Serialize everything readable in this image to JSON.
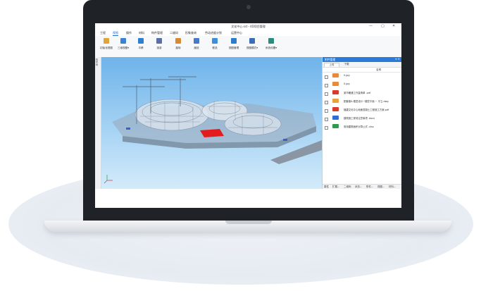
{
  "app": {
    "title": "文化中心.sst - 4D项目管理",
    "window_controls": [
      "—",
      "▢",
      "✕"
    ]
  },
  "menu": {
    "items": [
      "工程",
      "视图",
      "操作",
      "材料",
      "构件管理",
      "二维码",
      "形象查询",
      "劳动进度计划",
      "运营中心"
    ],
    "active": "视图"
  },
  "ribbon": {
    "tools": [
      {
        "label": "初始化视图",
        "icon": "reset-view-icon",
        "color": "#e0a43a"
      },
      {
        "label": "三维视图",
        "icon": "3d-view-icon",
        "color": "#3b82d6",
        "dropdown": "▾"
      },
      {
        "label": "平移",
        "icon": "pan-icon",
        "color": "#2f7fd1"
      },
      {
        "label": "漫游",
        "icon": "walkthrough-icon",
        "color": "#5a6ea8"
      },
      {
        "label": "旋转",
        "icon": "rotate-icon",
        "color": "#d98a32"
      },
      {
        "label": "缩放",
        "icon": "zoom-icon",
        "color": "#4a78c9"
      },
      {
        "label": "框选",
        "icon": "box-select-icon",
        "color": "#3c8fd8"
      },
      {
        "label": "视图管理",
        "icon": "view-manage-icon",
        "color": "#2d7cc9"
      },
      {
        "label": "视图模式",
        "icon": "view-mode-icon",
        "color": "#3a6fb6",
        "dropdown": "▾"
      },
      {
        "label": "系统设置",
        "icon": "system-settings-icon",
        "color": "#2a8c7a",
        "dropdown": "▾"
      }
    ]
  },
  "left_strip": {
    "label": "构件树"
  },
  "panel": {
    "title": "附件管理",
    "controls": "▾ ✕",
    "tabs": [
      "上传",
      "下载"
    ],
    "active_tab": "上传",
    "column": "名称",
    "files": [
      {
        "name": "0.jpg",
        "type_color": "#e98a3b"
      },
      {
        "name": "0.jpg",
        "type_color": "#e98a3b"
      },
      {
        "name": "某市暖通工作量清单 .pdf",
        "type_color": "#d83a2e"
      },
      {
        "name": "配套楼A-楼层设计~楼层平面 ~ 平立.dwg",
        "type_color": "#e7a23a"
      },
      {
        "name": "福建文化中心地面混凝土工程施工方案.pdf",
        "type_color": "#d83a2e"
      },
      {
        "name": "建筑施工现场注意事项 .docx",
        "type_color": "#2d6fd2"
      },
      {
        "name": "常用建筑面积计算公式 .xlsx",
        "type_color": "#2e9a4c"
      }
    ],
    "bottom_tabs": [
      "属性",
      "扩展...",
      "二维码",
      "状态...",
      "附件...",
      "视图...",
      "材料..."
    ]
  }
}
